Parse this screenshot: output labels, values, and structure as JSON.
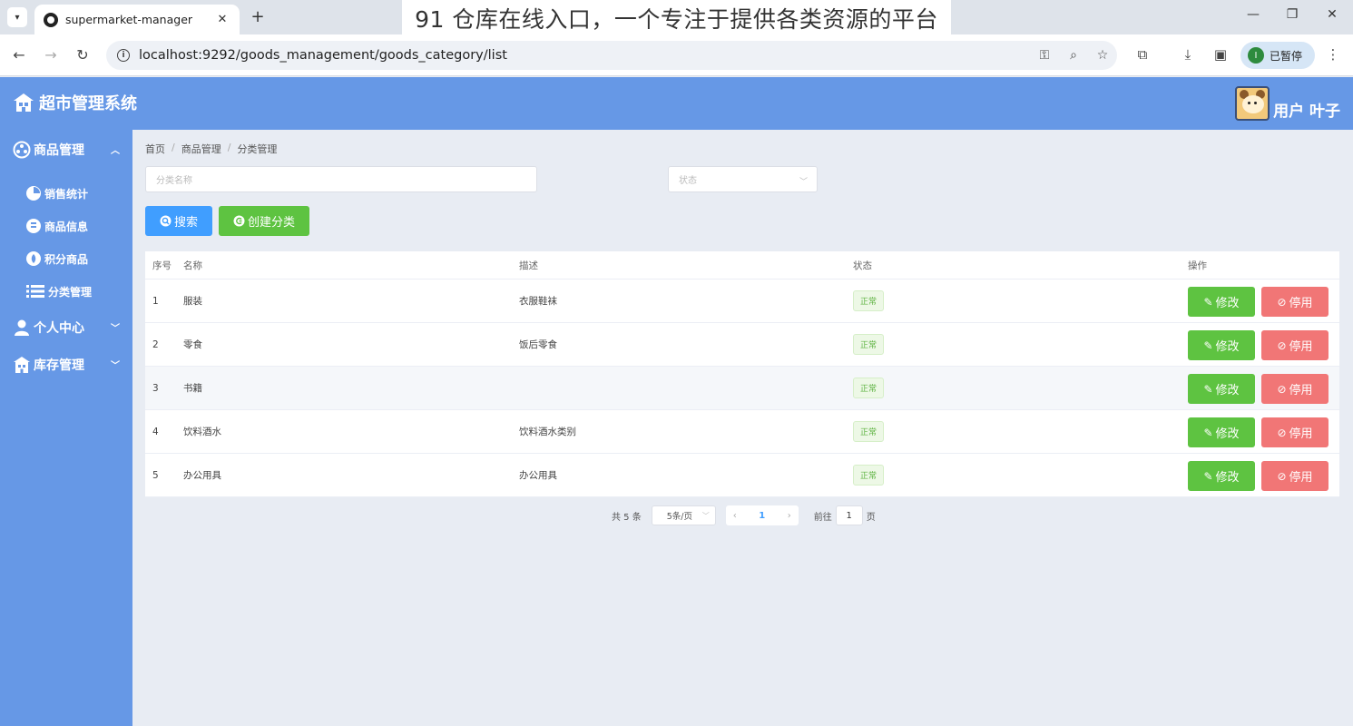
{
  "browser": {
    "tab_title": "supermarket-manager",
    "new_tab_symbol": "+",
    "overlay_text": "91 仓库在线入口，一个专注于提供各类资源的平台",
    "url": "localhost:9292/goods_management/goods_category/list",
    "profile_initial": "I",
    "profile_label": "已暂停"
  },
  "header": {
    "app_title": "超市管理系统",
    "user_label": "用户 叶子"
  },
  "sidebar": {
    "groups": [
      {
        "label": "商品管理",
        "icon": "chart-icon",
        "expanded": true
      },
      {
        "label": "个人中心",
        "icon": "user-icon",
        "expanded": false
      },
      {
        "label": "库存管理",
        "icon": "warehouse-icon",
        "expanded": false
      }
    ],
    "items": [
      {
        "label": "销售统计",
        "icon": "stats-icon"
      },
      {
        "label": "商品信息",
        "icon": "goods-info-icon"
      },
      {
        "label": "积分商品",
        "icon": "points-icon"
      },
      {
        "label": "分类管理",
        "icon": "list-icon",
        "active": true
      }
    ]
  },
  "breadcrumb": [
    "首页",
    "商品管理",
    "分类管理"
  ],
  "filters": {
    "name_placeholder": "分类名称",
    "status_placeholder": "状态"
  },
  "actions": {
    "search_label": "搜索",
    "create_label": "创建分类"
  },
  "table": {
    "headers": [
      "序号",
      "名称",
      "描述",
      "状态",
      "操作"
    ],
    "rows": [
      {
        "idx": "1",
        "name": "服装",
        "desc": "衣服鞋袜",
        "status": "正常"
      },
      {
        "idx": "2",
        "name": "零食",
        "desc": "饭后零食",
        "status": "正常"
      },
      {
        "idx": "3",
        "name": "书籍",
        "desc": "",
        "status": "正常"
      },
      {
        "idx": "4",
        "name": "饮料酒水",
        "desc": "饮料酒水类别",
        "status": "正常"
      },
      {
        "idx": "5",
        "name": "办公用具",
        "desc": "办公用具",
        "status": "正常"
      }
    ],
    "edit_label": "修改",
    "disable_label": "停用"
  },
  "pagination": {
    "total_text": "共 5 条",
    "page_size": "5条/页",
    "current_page": "1",
    "goto_label": "前往",
    "goto_value": "1",
    "page_suffix": "页"
  },
  "colors": {
    "theme_blue": "#6698e6",
    "primary": "#409eff",
    "success": "#5ec341",
    "danger": "#f17676"
  }
}
